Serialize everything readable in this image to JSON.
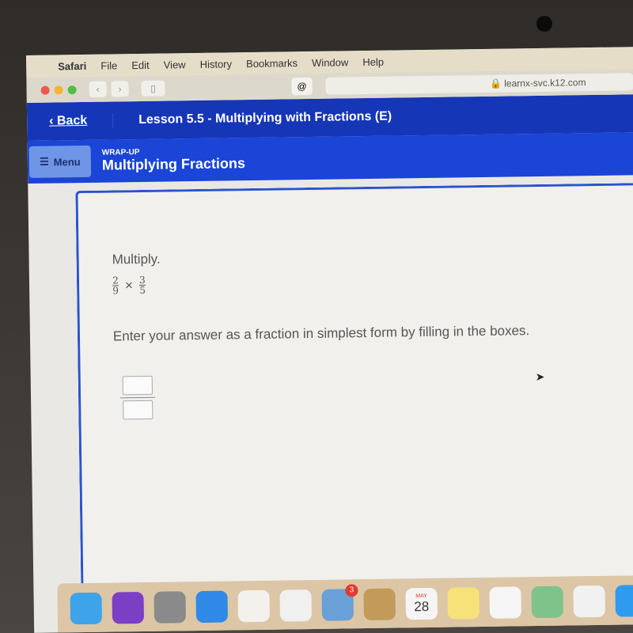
{
  "menubar": {
    "apple": "",
    "items": [
      "Safari",
      "File",
      "Edit",
      "View",
      "History",
      "Bookmarks",
      "Window",
      "Help"
    ]
  },
  "toolbar": {
    "back": "‹",
    "forward": "›",
    "sidebar": "▯",
    "extension": "@",
    "url": "🔒 learnx-svc.k12.com"
  },
  "header": {
    "back_label": "‹ Back",
    "lesson_title": "Lesson 5.5 - Multiplying with Fractions (E)"
  },
  "subheader": {
    "menu_label": "Menu",
    "section": "WRAP-UP",
    "title": "Multiplying Fractions"
  },
  "question": {
    "prompt": "Multiply.",
    "fraction1": {
      "numerator": "2",
      "denominator": "9"
    },
    "operator": "×",
    "fraction2": {
      "numerator": "3",
      "denominator": "5"
    },
    "instruction": "Enter your answer as a fraction in simplest form by filling in the boxes.",
    "answer": {
      "numerator": "",
      "denominator": ""
    }
  },
  "dock": {
    "apps": [
      {
        "name": "finder",
        "color": "#3fa3ea"
      },
      {
        "name": "siri",
        "color": "#7b3fc4"
      },
      {
        "name": "launchpad",
        "color": "#8a8a8a"
      },
      {
        "name": "safari",
        "color": "#2e8ae6"
      },
      {
        "name": "document",
        "color": "#f3f1ec"
      },
      {
        "name": "chrome",
        "color": "#f0f0f0"
      },
      {
        "name": "preview",
        "color": "#6aa0d8",
        "badge": "3"
      },
      {
        "name": "contacts",
        "color": "#c49a5a"
      },
      {
        "name": "calendar",
        "color": "#f5f5f5",
        "month": "MAY",
        "day": "28"
      },
      {
        "name": "notes",
        "color": "#f7e27a"
      },
      {
        "name": "reminders",
        "color": "#f5f5f5"
      },
      {
        "name": "maps",
        "color": "#7fc38a"
      },
      {
        "name": "photos",
        "color": "#f1f1f1"
      },
      {
        "name": "messages",
        "color": "#2f9bf0"
      }
    ]
  }
}
